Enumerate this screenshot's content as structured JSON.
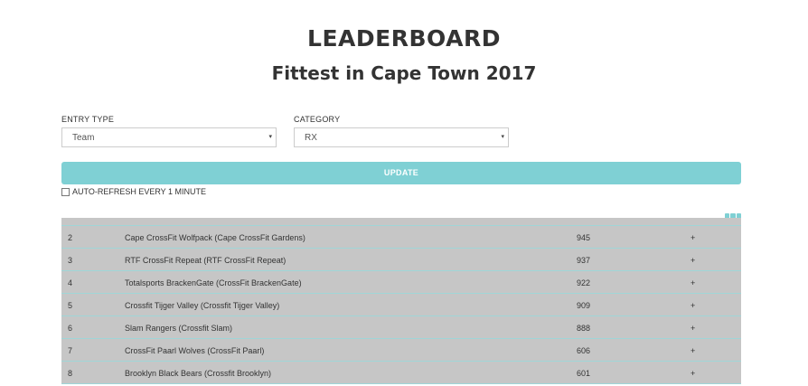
{
  "header": {
    "title": "LEADERBOARD",
    "subtitle": "Fittest in Cape Town 2017"
  },
  "filters": {
    "entry_type": {
      "label": "ENTRY TYPE",
      "value": "Team",
      "caret": "▾"
    },
    "category": {
      "label": "CATEGORY",
      "value": "RX",
      "caret": "▾"
    }
  },
  "update_button": {
    "label": "UPDATE"
  },
  "auto_refresh": {
    "label": "AUTO-REFRESH EVERY 1 MINUTE",
    "checked": false
  },
  "leaderboard": {
    "rows": [
      {
        "rank": "2",
        "team": "Cape CrossFit Wolfpack (Cape CrossFit Gardens)",
        "points": "945",
        "expand": "+"
      },
      {
        "rank": "3",
        "team": "RTF CrossFit Repeat (RTF CrossFit Repeat)",
        "points": "937",
        "expand": "+"
      },
      {
        "rank": "4",
        "team": "Totalsports BrackenGate (CrossFit BrackenGate)",
        "points": "922",
        "expand": "+"
      },
      {
        "rank": "5",
        "team": "Crossfit Tijger Valley (Crossfit Tijger Valley)",
        "points": "909",
        "expand": "+"
      },
      {
        "rank": "6",
        "team": "Slam Rangers (Crossfit Slam)",
        "points": "888",
        "expand": "+"
      },
      {
        "rank": "7",
        "team": "CrossFit Paarl Wolves (CrossFit Paarl)",
        "points": "606",
        "expand": "+"
      },
      {
        "rank": "8",
        "team": "Brooklyn Black Bears (Crossfit Brooklyn)",
        "points": "601",
        "expand": "+"
      }
    ]
  },
  "colors": {
    "accent": "#7fd0d4",
    "table_bg": "#c6c6c6",
    "row_border": "#9fd6d8"
  },
  "icons": {
    "column_toggle": "grid-icon"
  }
}
